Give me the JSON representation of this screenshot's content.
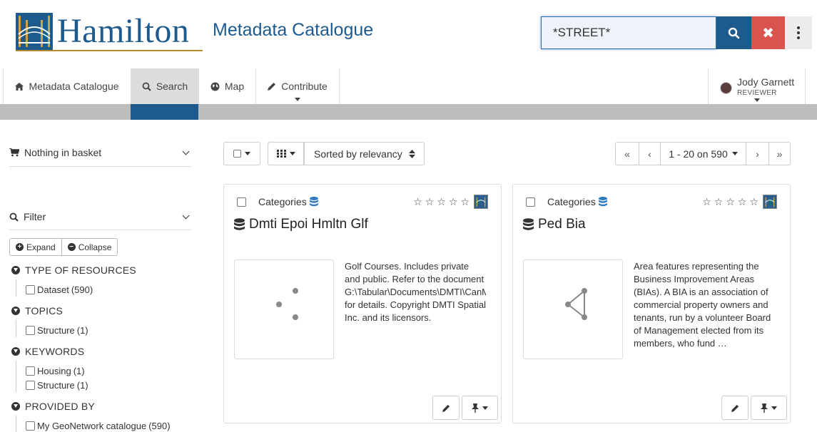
{
  "header": {
    "logo_text": "Hamilton",
    "site_title": "Metadata Catalogue",
    "search_value": "*STREET*"
  },
  "nav": {
    "items": [
      {
        "label": "Metadata Catalogue",
        "icon": "home-icon"
      },
      {
        "label": "Search",
        "icon": "search-icon",
        "active": true
      },
      {
        "label": "Map",
        "icon": "globe-icon"
      },
      {
        "label": "Contribute",
        "icon": "pencil-icon"
      }
    ],
    "user": {
      "name": "Jody Garnett",
      "role": "REVIEWER"
    }
  },
  "sidebar": {
    "basket": "Nothing in basket",
    "filter": "Filter",
    "expand": "Expand",
    "collapse": "Collapse",
    "facets": [
      {
        "title": "TYPE OF RESOURCES",
        "items": [
          {
            "label": "Dataset",
            "count": "(590)"
          }
        ]
      },
      {
        "title": "TOPICS",
        "items": [
          {
            "label": "Structure",
            "count": "(1)"
          }
        ]
      },
      {
        "title": "KEYWORDS",
        "items": [
          {
            "label": "Housing",
            "count": "(1)"
          },
          {
            "label": "Structure",
            "count": "(1)"
          }
        ]
      },
      {
        "title": "PROVIDED BY",
        "items": [
          {
            "label": "My GeoNetwork catalogue",
            "count": "(590)"
          }
        ]
      }
    ]
  },
  "toolbar": {
    "sort_label": "Sorted by relevancy",
    "page_range": "1 - 20 on 590"
  },
  "results": [
    {
      "categories_label": "Categories",
      "title": "Dmti Epoi Hmltn Glf",
      "description": "Golf Courses. Includes private and public. Refer to the document G:\\Tabular\\Documents\\DMTI\\CanMap for details. Copyright DMTI Spatial Inc. and its licensors."
    },
    {
      "categories_label": "Categories",
      "title": "Ped Bia",
      "description": "Area features representing the Business Improvement Areas (BIAs). A BIA is an association of commercial property owners and tenants, run by a volunteer Board of Management elected from its members, who fund …"
    }
  ],
  "colors": {
    "brand": "#1d5a8d",
    "danger": "#d9534f",
    "gold": "#b48b2e"
  }
}
